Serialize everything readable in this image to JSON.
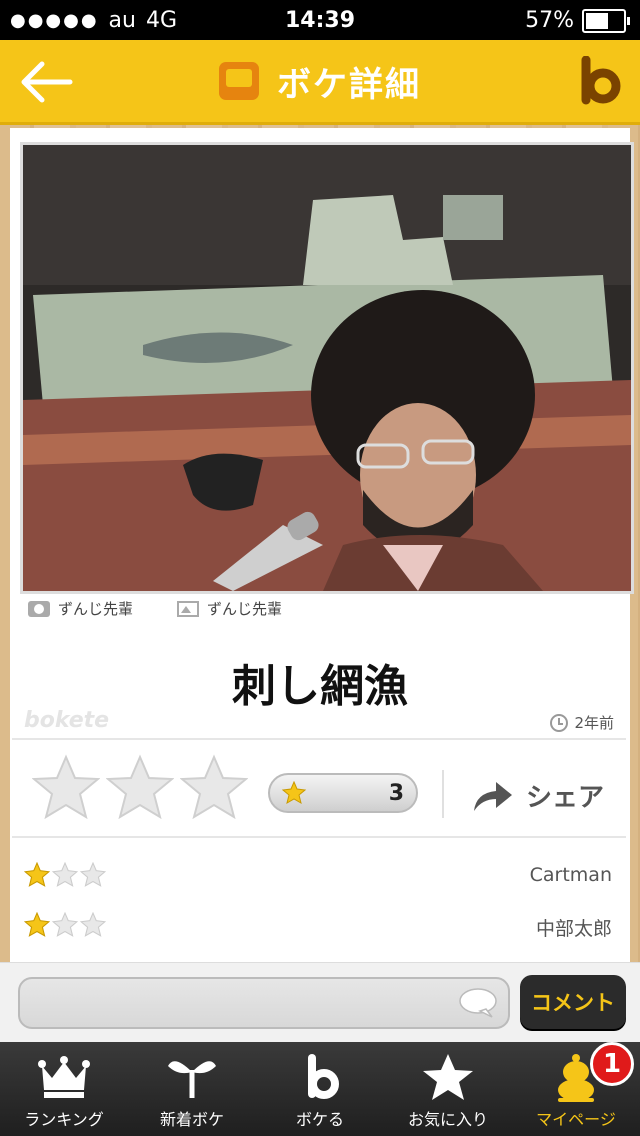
{
  "status_bar": {
    "carrier": "au",
    "network": "4G",
    "time": "14:39",
    "battery": "57%",
    "battery_level": 0.57
  },
  "nav": {
    "title": "ボケ詳細",
    "back_icon": "back-arrow-icon",
    "logo_icon": "bokete-logo-icon"
  },
  "post": {
    "photo_by": "ずんじ先輩",
    "image_by": "ずんじ先輩",
    "title": "刺し網漁",
    "watermark": "bokete",
    "age": "2年前"
  },
  "rating": {
    "star_count": "3",
    "share_label": "シェア",
    "stars_selected": 0,
    "stars_total": 3
  },
  "votes": [
    {
      "stars": 1,
      "user": "Cartman"
    },
    {
      "stars": 1,
      "user": "中部太郎"
    }
  ],
  "comment": {
    "placeholder": "",
    "button_label": "コメント"
  },
  "tabbar": {
    "items": [
      {
        "label": "ランキング",
        "icon": "crown-icon"
      },
      {
        "label": "新着ボケ",
        "icon": "sprout-icon"
      },
      {
        "label": "ボケる",
        "icon": "bokete-b-icon"
      },
      {
        "label": "お気に入り",
        "icon": "star-icon"
      },
      {
        "label": "マイページ",
        "icon": "mypage-character-icon",
        "badge": "1"
      }
    ]
  },
  "colors": {
    "brand": "#f5c518",
    "accent_orange": "#e6840f",
    "badge": "#e01a1a"
  }
}
